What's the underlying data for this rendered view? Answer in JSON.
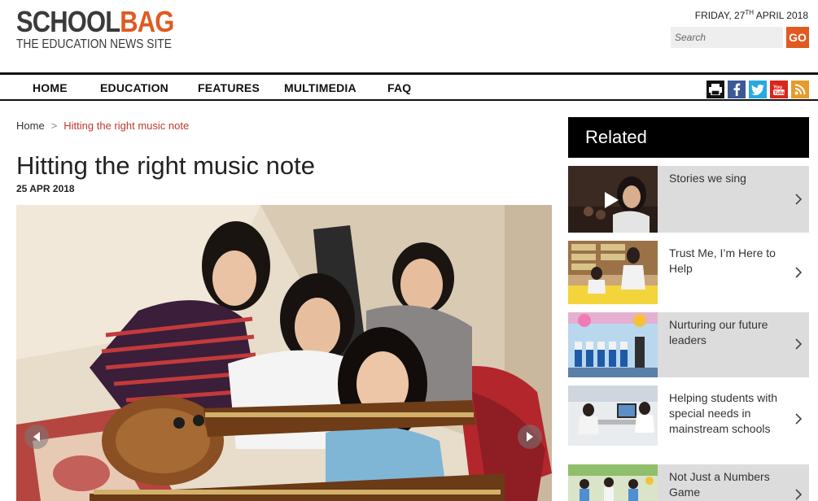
{
  "header": {
    "logo_school": "SCHOOL",
    "logo_bag": "BAG",
    "logo_tagline": "THE EDUCATION NEWS SITE",
    "date_prefix": "FRIDAY, 27",
    "date_sup": "TH",
    "date_suffix": " APRIL 2018",
    "search_placeholder": "Search",
    "go_label": "GO"
  },
  "nav": {
    "items": [
      "HOME",
      "EDUCATION",
      "FEATURES",
      "MULTIMEDIA",
      "FAQ"
    ]
  },
  "social": [
    {
      "icon": "print-icon",
      "color": "#111111"
    },
    {
      "icon": "facebook-icon",
      "color": "#3b5998"
    },
    {
      "icon": "twitter-icon",
      "color": "#29a9e1"
    },
    {
      "icon": "youtube-icon",
      "color": "#d9261c"
    },
    {
      "icon": "rss-icon",
      "color": "#e69b2a"
    }
  ],
  "breadcrumb": {
    "home": "Home",
    "separator": ">",
    "current": "Hitting the right music note"
  },
  "article": {
    "title": "Hitting the right music note",
    "date": "25 APR 2018"
  },
  "related": {
    "heading": "Related",
    "items": [
      {
        "title": "Stories we sing"
      },
      {
        "title": "Trust Me, I’m Here to Help"
      },
      {
        "title": "Nurturing our future leaders"
      },
      {
        "title": "Helping students with special needs in mainstream schools"
      },
      {
        "title": "Not Just a Numbers Game"
      }
    ]
  },
  "colors": {
    "accent": "#e05a22",
    "breadcrumb_current": "#c0392b",
    "related_highlight_bg": "#dcdcdc"
  }
}
